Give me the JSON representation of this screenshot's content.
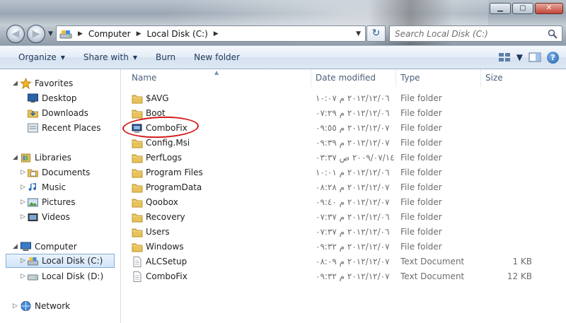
{
  "window": {
    "min_symbol": "▁",
    "max_symbol": "▢",
    "close_symbol": "✕"
  },
  "nav": {
    "back_symbol": "◀",
    "forward_symbol": "▶",
    "history_symbol": "▼",
    "refresh_symbol": "↻"
  },
  "address": {
    "crumbs": [
      "Computer",
      "Local Disk (C:)"
    ],
    "separator": "▶",
    "dropdown_symbol": "▼"
  },
  "search": {
    "placeholder": "Search Local Disk (C:)"
  },
  "toolbar": {
    "organize": "Organize",
    "share_with": "Share with",
    "burn": "Burn",
    "new_folder": "New folder",
    "dropdown_symbol": "▼",
    "help_symbol": "?"
  },
  "sidebar": {
    "favorites": {
      "label": "Favorites",
      "items": [
        "Desktop",
        "Downloads",
        "Recent Places"
      ]
    },
    "libraries": {
      "label": "Libraries",
      "items": [
        "Documents",
        "Music",
        "Pictures",
        "Videos"
      ]
    },
    "computer": {
      "label": "Computer",
      "items": [
        "Local Disk (C:)",
        "Local Disk (D:)"
      ]
    },
    "network": {
      "label": "Network"
    },
    "expand_symbol": "▷",
    "collapse_symbol": "◢"
  },
  "columns": {
    "name": "Name",
    "date_modified": "Date modified",
    "type": "Type",
    "size": "Size",
    "sort_symbol": "▲"
  },
  "files": [
    {
      "name": "$AVG",
      "date": "٢٠١٢/١٢/٠٦ م ١٠:٠٧",
      "type": "File folder",
      "size": "",
      "icon": "folder-icon"
    },
    {
      "name": "Boot",
      "date": "٢٠١٢/١٢/٠٦ م ٠٧:٢٩",
      "type": "File folder",
      "size": "",
      "icon": "folder-icon"
    },
    {
      "name": "ComboFix",
      "date": "٢٠١٢/١٢/٠٧ م ٠٩:٥٥",
      "type": "File folder",
      "size": "",
      "icon": "combofix-folder-icon"
    },
    {
      "name": "Config.Msi",
      "date": "٢٠١٢/١٢/٠٧ م ٠٩:٣٩",
      "type": "File folder",
      "size": "",
      "icon": "folder-icon"
    },
    {
      "name": "PerfLogs",
      "date": "٢٠٠٩/٠٧/١٤ ص ٠٣:٣٧",
      "type": "File folder",
      "size": "",
      "icon": "folder-icon"
    },
    {
      "name": "Program Files",
      "date": "٢٠١٢/١٢/٠٦ م ١٠:٠١",
      "type": "File folder",
      "size": "",
      "icon": "folder-icon"
    },
    {
      "name": "ProgramData",
      "date": "٢٠١٢/١٢/٠٧ م ٠٨:٢٨",
      "type": "File folder",
      "size": "",
      "icon": "folder-icon"
    },
    {
      "name": "Qoobox",
      "date": "٢٠١٢/١٢/٠٧ م ٠٩:٤٠",
      "type": "File folder",
      "size": "",
      "icon": "folder-icon"
    },
    {
      "name": "Recovery",
      "date": "٢٠١٢/١٢/٠٦ م ٠٧:٣٧",
      "type": "File folder",
      "size": "",
      "icon": "folder-icon"
    },
    {
      "name": "Users",
      "date": "٢٠١٢/١٢/٠٦ م ٠٧:٣٧",
      "type": "File folder",
      "size": "",
      "icon": "folder-icon"
    },
    {
      "name": "Windows",
      "date": "٢٠١٢/١٢/٠٧ م ٠٩:٣٢",
      "type": "File folder",
      "size": "",
      "icon": "folder-icon"
    },
    {
      "name": "ALCSetup",
      "date": "٢٠١٢/١٢/٠٧ م ٠٨:٠٩",
      "type": "Text Document",
      "size": "1 KB",
      "icon": "text-document-icon"
    },
    {
      "name": "ComboFix",
      "date": "٢٠١٢/١٢/٠٧ م ٠٩:٣٢",
      "type": "Text Document",
      "size": "12 KB",
      "icon": "text-document-icon"
    }
  ],
  "colors": {
    "folder": "#e8c25a",
    "selection": "#cce4fa",
    "annotation": "#d41c1c",
    "link_text": "#1e395b"
  }
}
